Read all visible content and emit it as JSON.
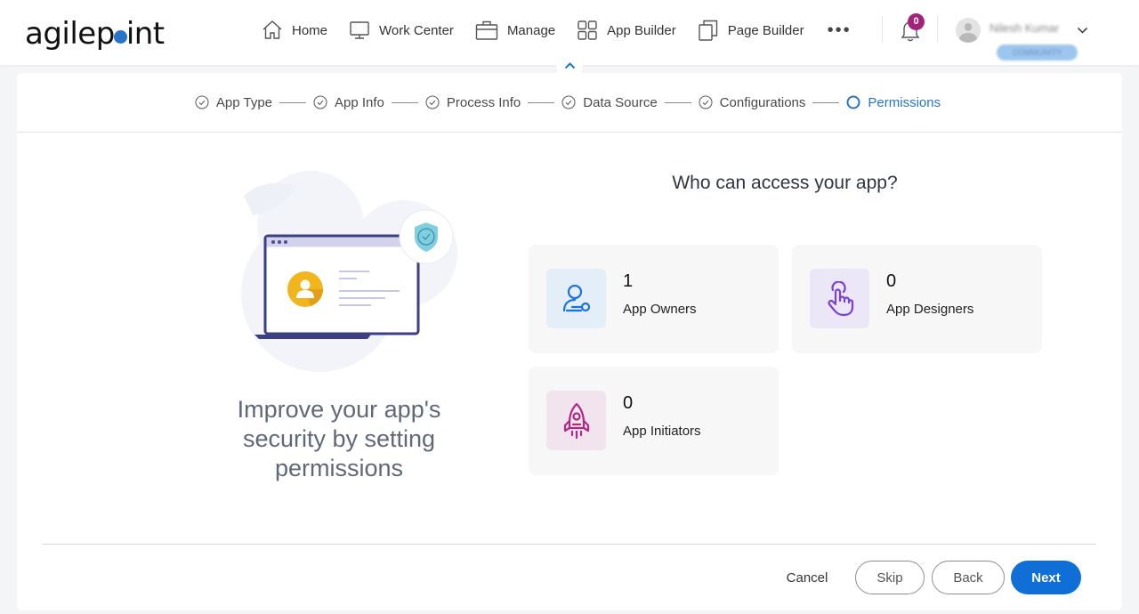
{
  "header": {
    "logo_text_left": "agilep",
    "logo_text_right": "int",
    "nav": [
      {
        "label": "Home",
        "icon": "home-icon"
      },
      {
        "label": "Work Center",
        "icon": "monitor-icon"
      },
      {
        "label": "Manage",
        "icon": "briefcase-icon"
      },
      {
        "label": "App Builder",
        "icon": "grid-icon"
      },
      {
        "label": "Page Builder",
        "icon": "copy-icon"
      }
    ],
    "more_label": "•••",
    "notification_count": "0",
    "user_name": "Nilesh Kumar",
    "user_badge": "COMMUNITY"
  },
  "stepper": {
    "steps": [
      {
        "label": "App Type",
        "status": "completed"
      },
      {
        "label": "App Info",
        "status": "completed"
      },
      {
        "label": "Process Info",
        "status": "completed"
      },
      {
        "label": "Data Source",
        "status": "completed"
      },
      {
        "label": "Configurations",
        "status": "completed"
      },
      {
        "label": "Permissions",
        "status": "active"
      }
    ]
  },
  "main": {
    "tagline": "Improve your app's security by setting permissions",
    "question": "Who can access your app?",
    "permissions": [
      {
        "count": "1",
        "label": "App Owners",
        "icon": "user-key-icon",
        "color": "#1a73d9",
        "bg": "#e3eef9"
      },
      {
        "count": "0",
        "label": "App Designers",
        "icon": "hand-pointer-icon",
        "color": "#7a3fd6",
        "bg": "#ece7f6"
      },
      {
        "count": "0",
        "label": "App Initiators",
        "icon": "rocket-icon",
        "color": "#b0287f",
        "bg": "#f2e4ee"
      }
    ]
  },
  "footer": {
    "cancel": "Cancel",
    "skip": "Skip",
    "back": "Back",
    "next": "Next"
  },
  "colors": {
    "accent": "#0f6fd6",
    "badge": "#a4237a"
  }
}
